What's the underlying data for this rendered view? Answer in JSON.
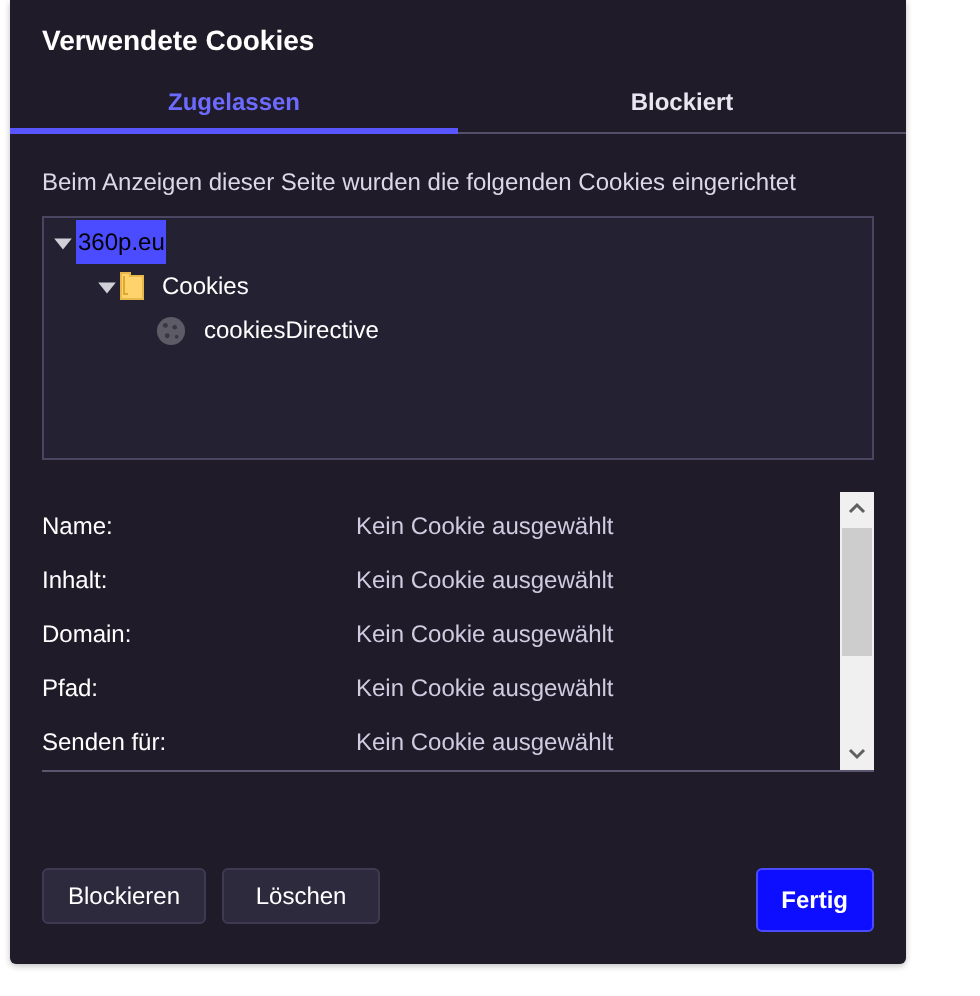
{
  "dialog": {
    "title": "Verwendete Cookies"
  },
  "tabs": [
    {
      "label": "Zugelassen",
      "selected": true
    },
    {
      "label": "Blockiert",
      "selected": false
    }
  ],
  "description": "Beim Anzeigen dieser Seite wurden die folgenden Cookies eingerichtet",
  "tree": [
    {
      "label": "360p.eu",
      "selected": true,
      "expanded": true,
      "children": [
        {
          "kind": "folder",
          "label": "Cookies",
          "selected": false,
          "expanded": true,
          "children": [
            {
              "kind": "cookie",
              "label": "cookiesDirective",
              "selected": false
            }
          ]
        }
      ]
    }
  ],
  "details": [
    {
      "label": "Name:",
      "value": "Kein Cookie ausgewählt"
    },
    {
      "label": "Inhalt:",
      "value": "Kein Cookie ausgewählt"
    },
    {
      "label": "Domain:",
      "value": "Kein Cookie ausgewählt"
    },
    {
      "label": "Pfad:",
      "value": "Kein Cookie ausgewählt"
    },
    {
      "label": "Senden für:",
      "value": "Kein Cookie ausgewählt"
    }
  ],
  "buttons": [
    {
      "label": "Blockieren",
      "kind": "secondary"
    },
    {
      "label": "Löschen",
      "kind": "secondary"
    },
    {
      "label": "Fertig",
      "kind": "primary"
    }
  ]
}
